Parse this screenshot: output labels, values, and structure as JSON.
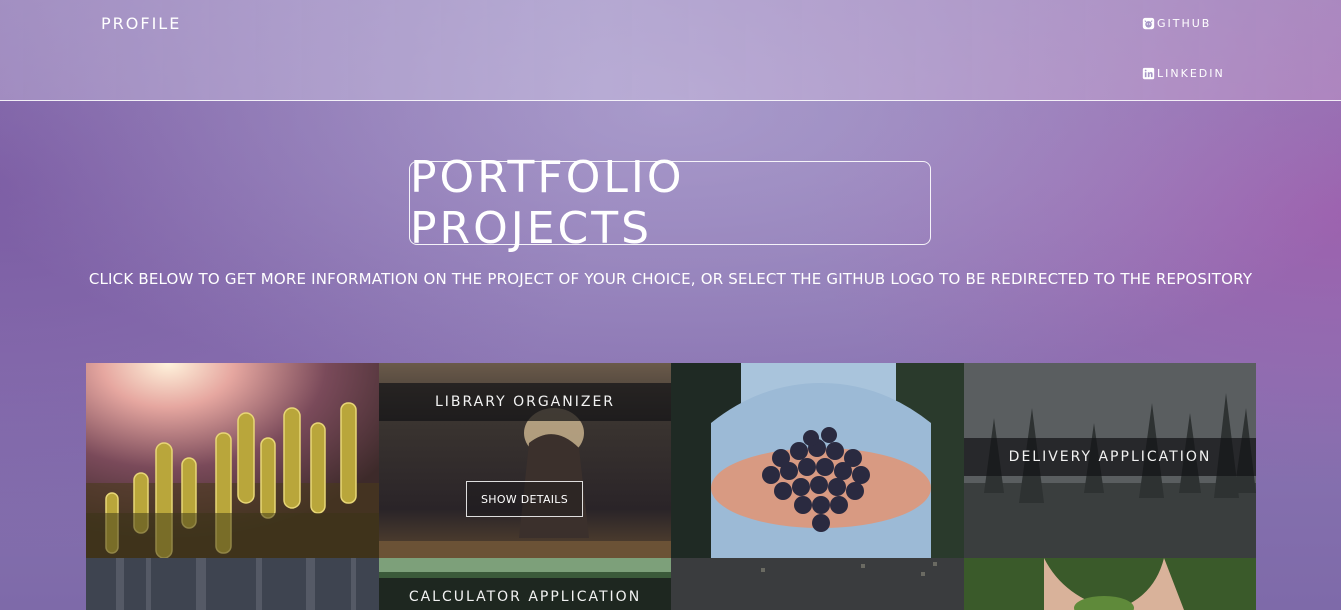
{
  "header": {
    "brand": "PROFILE",
    "links": [
      {
        "label": "GITHUB",
        "icon": "github-icon"
      },
      {
        "label": "LINKEDIN",
        "icon": "linkedin-icon"
      }
    ]
  },
  "hero": {
    "title": "PORTFOLIO PROJECTS",
    "subtitle": "CLICK BELOW TO GET MORE INFORMATION ON THE PROJECT OF YOUR CHOICE, OR SELECT THE GITHUB LOGO TO BE REDIRECTED TO THE REPOSITORY"
  },
  "projects": [
    {
      "image": "cactus-sunset-photo",
      "caption": ""
    },
    {
      "image": "woman-by-lake-photo",
      "caption": "LIBRARY ORGANIZER",
      "button": "SHOW DETAILS"
    },
    {
      "image": "hands-holding-grapes-photo",
      "caption": ""
    },
    {
      "image": "misty-pine-forest-photo",
      "caption": "DELIVERY APPLICATION"
    },
    {
      "image": "forest-trunks-photo",
      "caption": ""
    },
    {
      "image": "tree-canopy-photo",
      "caption": "CALCULATOR APPLICATION"
    },
    {
      "image": "city-lights-bokeh-photo",
      "caption": ""
    },
    {
      "image": "hands-holding-plant-photo",
      "caption": ""
    }
  ],
  "colors": {
    "background_purple": "#8a74b2",
    "caption_bar": "#141416"
  }
}
